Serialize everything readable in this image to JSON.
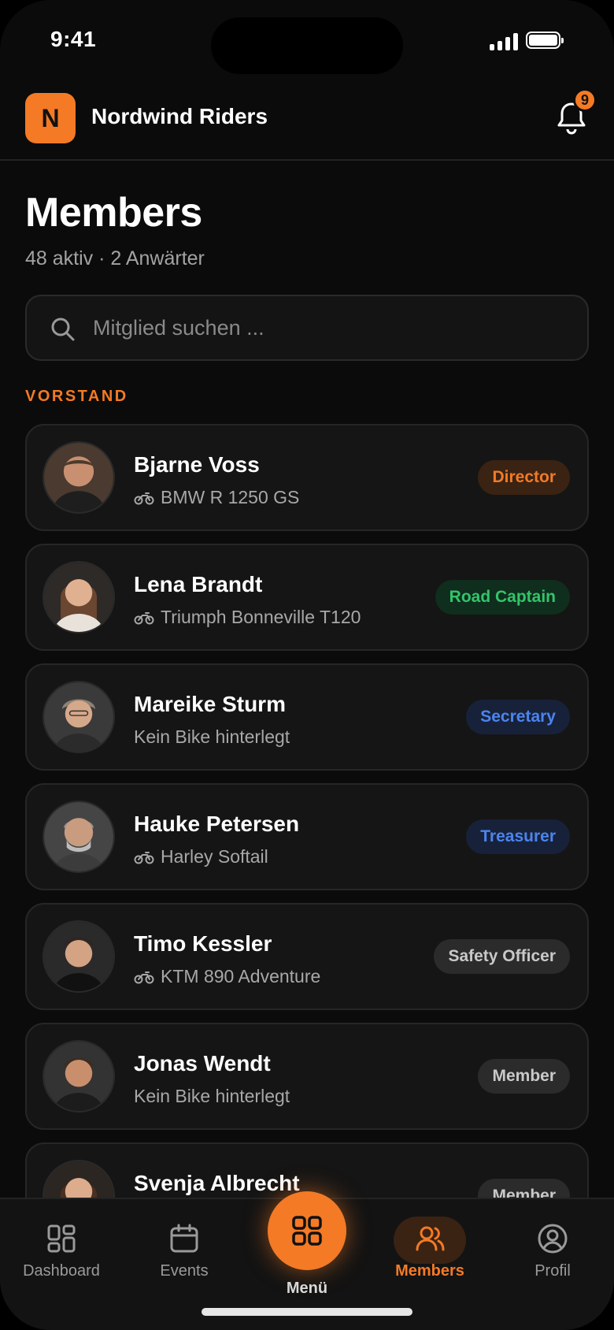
{
  "status_bar": {
    "time": "9:41"
  },
  "header": {
    "logo_letter": "N",
    "club_name": "Nordwind Riders",
    "notification_count": "9"
  },
  "page": {
    "title": "Members",
    "subtitle": "48 aktiv · 2 Anwärter"
  },
  "search": {
    "placeholder": "Mitglied suchen ..."
  },
  "section": {
    "label": "VORSTAND"
  },
  "members": [
    {
      "name": "Bjarne Voss",
      "bike": "BMW R 1250 GS",
      "has_bike": true,
      "role": "Director"
    },
    {
      "name": "Lena Brandt",
      "bike": "Triumph Bonneville T120",
      "has_bike": true,
      "role": "Road Captain"
    },
    {
      "name": "Mareike Sturm",
      "bike": "Kein Bike hinterlegt",
      "has_bike": false,
      "role": "Secretary"
    },
    {
      "name": "Hauke Petersen",
      "bike": "Harley Softail",
      "has_bike": true,
      "role": "Treasurer"
    },
    {
      "name": "Timo Kessler",
      "bike": "KTM 890 Adventure",
      "has_bike": true,
      "role": "Safety Officer"
    },
    {
      "name": "Jonas Wendt",
      "bike": "Kein Bike hinterlegt",
      "has_bike": false,
      "role": "Member"
    },
    {
      "name": "Svenja Albrecht",
      "bike": "",
      "has_bike": true,
      "role": "Member"
    }
  ],
  "bottom_nav": {
    "items": [
      {
        "label": "Dashboard",
        "icon": "dashboard-icon"
      },
      {
        "label": "Events",
        "icon": "calendar-icon"
      },
      {
        "label": "Menü",
        "icon": "grid-icon"
      },
      {
        "label": "Members",
        "icon": "users-icon",
        "active": true
      },
      {
        "label": "Profil",
        "icon": "profile-icon"
      }
    ]
  },
  "colors": {
    "accent": "#f47a25",
    "background": "#0b0b0b",
    "card": "#151515",
    "green": "#34c46a",
    "blue": "#4c84ee"
  }
}
